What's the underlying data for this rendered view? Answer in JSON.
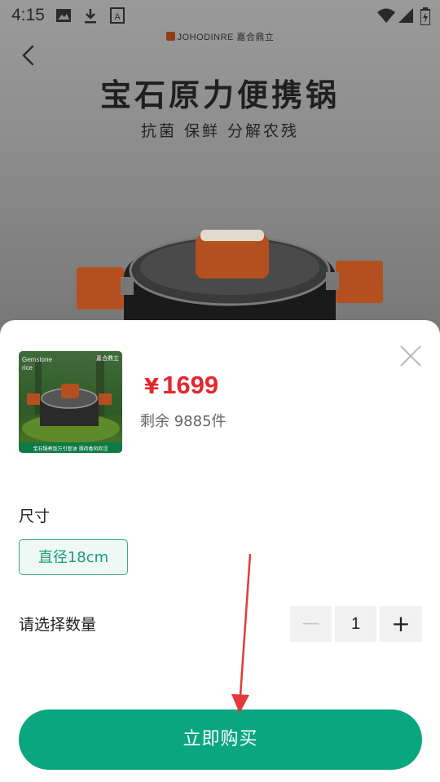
{
  "status_bar": {
    "time": "4:15",
    "left_icons": [
      "image-icon",
      "download-icon",
      "text-icon"
    ],
    "right_icons": [
      "wifi-icon",
      "signal-icon",
      "battery-icon"
    ]
  },
  "banner": {
    "brand": "JOHODINRE 嘉合鼎立",
    "title": "宝石原力便携锅",
    "subtitle": "抗菌  保鲜  分解农残"
  },
  "product_thumb": {
    "caption": "Gemstone rice",
    "brand": "嘉合鼎立",
    "footer": "宝石锅煮饭万引管油 薄荷香风吹涩"
  },
  "sheet": {
    "price_symbol": "¥",
    "price": "1699",
    "stock": "剩余 9885件",
    "size_label": "尺寸",
    "size_option": "直径18cm",
    "quantity_label": "请选择数量",
    "quantity_value": "1",
    "minus_label": "—",
    "plus_label": "+",
    "buy_label": "立即购买"
  },
  "colors": {
    "accent": "#0aa67f",
    "price": "#e3272d",
    "annotation": "#e5393b"
  }
}
